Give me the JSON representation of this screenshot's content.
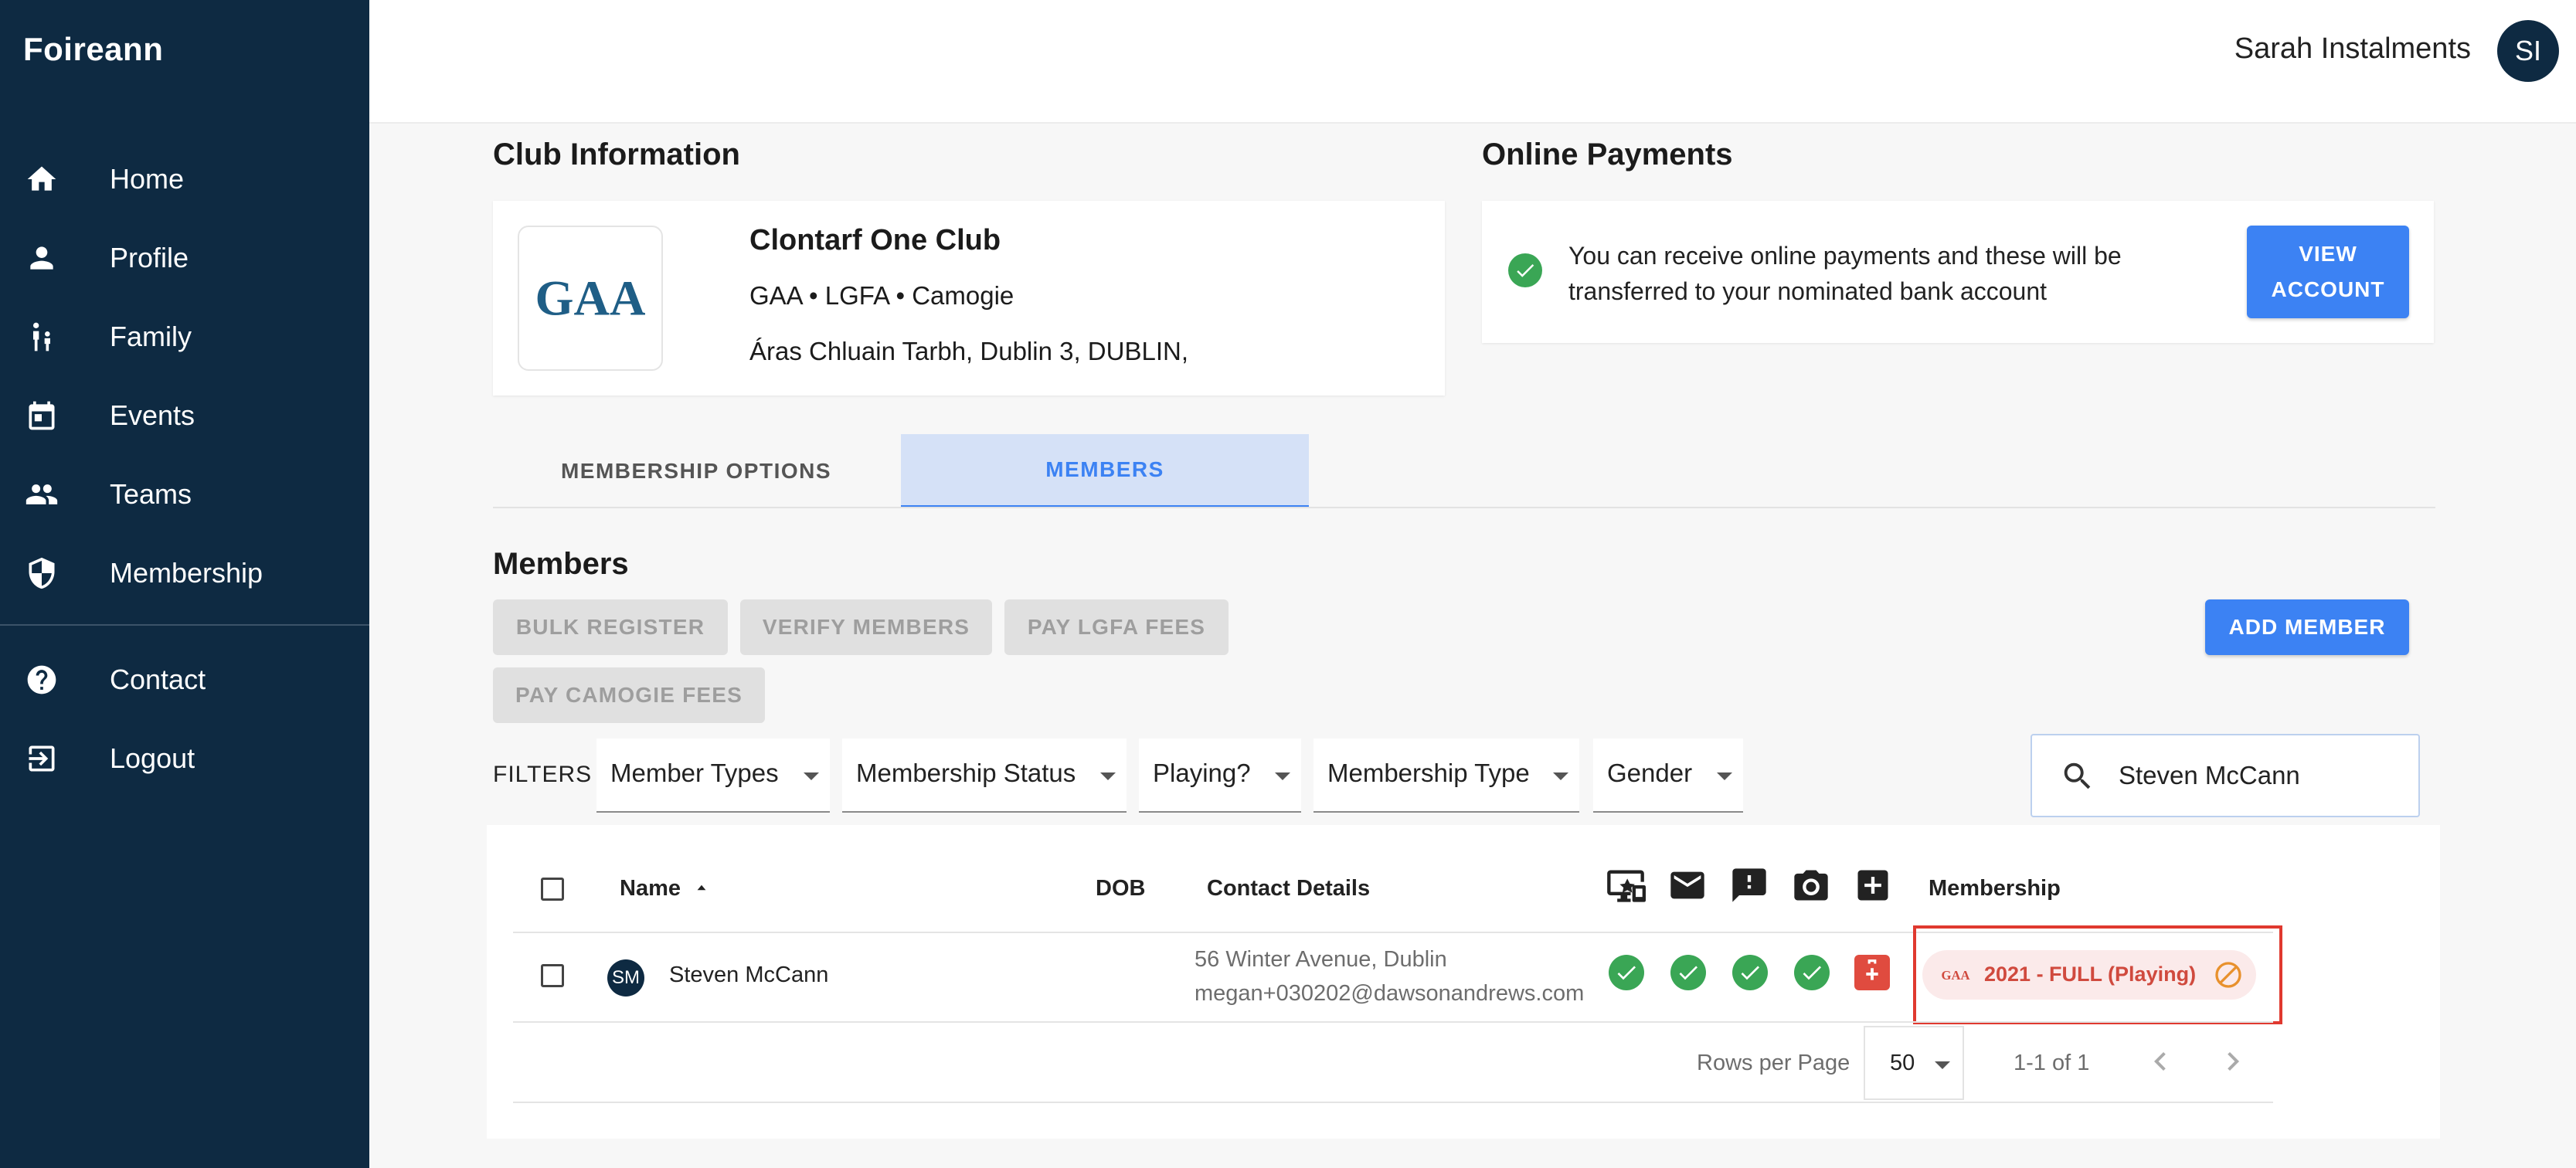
{
  "app": {
    "brand": "Foireann"
  },
  "sidebar": {
    "items": [
      {
        "label": "Home",
        "icon": "home-icon"
      },
      {
        "label": "Profile",
        "icon": "person-icon"
      },
      {
        "label": "Family",
        "icon": "family-icon"
      },
      {
        "label": "Events",
        "icon": "calendar-icon"
      },
      {
        "label": "Teams",
        "icon": "group-icon"
      },
      {
        "label": "Membership",
        "icon": "shield-icon"
      }
    ],
    "secondary": [
      {
        "label": "Contact",
        "icon": "help-icon"
      },
      {
        "label": "Logout",
        "icon": "logout-icon"
      }
    ]
  },
  "header": {
    "user_name": "Sarah Instalments",
    "avatar_initials": "SI"
  },
  "club_info": {
    "title": "Club Information",
    "logo_text": "GAA",
    "name": "Clontarf One Club",
    "associations": "GAA • LGFA • Camogie",
    "address": "Áras Chluain Tarbh, Dublin 3, DUBLIN,"
  },
  "online_payments": {
    "title": "Online Payments",
    "message": "You can receive online payments and these will be transferred to your nominated bank account",
    "button_line1": "VIEW",
    "button_line2": "ACCOUNT"
  },
  "tabs": [
    {
      "label": "MEMBERSHIP OPTIONS",
      "active": false
    },
    {
      "label": "MEMBERS",
      "active": true
    }
  ],
  "members": {
    "title": "Members",
    "actions": [
      "BULK REGISTER",
      "VERIFY MEMBERS",
      "PAY LGFA FEES",
      "PAY CAMOGIE FEES"
    ],
    "add_button": "ADD MEMBER",
    "filters_label": "FILTERS",
    "filters": [
      "Member Types",
      "Membership Status",
      "Playing?",
      "Membership Type",
      "Gender"
    ],
    "search_value": "Steven McCann"
  },
  "table": {
    "columns": {
      "name": "Name",
      "dob": "DOB",
      "contact": "Contact Details",
      "membership": "Membership"
    },
    "header_icons": [
      "online-consent-icon",
      "email-icon",
      "alert-icon",
      "camera-icon",
      "medical-icon"
    ],
    "rows": [
      {
        "initials": "SM",
        "name": "Steven McCann",
        "dob": "",
        "address": "56 Winter Avenue, Dublin",
        "email": "megan+030202@dawsonandrews.com",
        "membership": "2021 - FULL (Playing)"
      }
    ],
    "rows_per_page_label": "Rows per Page",
    "rows_per_page": "50",
    "range": "1-1 of 1"
  },
  "colors": {
    "sidebar": "#0e2a42",
    "accent": "#3c82f3",
    "success": "#3aa655",
    "danger": "#e04b3f",
    "active_tab_bg": "#d5e1f7"
  }
}
